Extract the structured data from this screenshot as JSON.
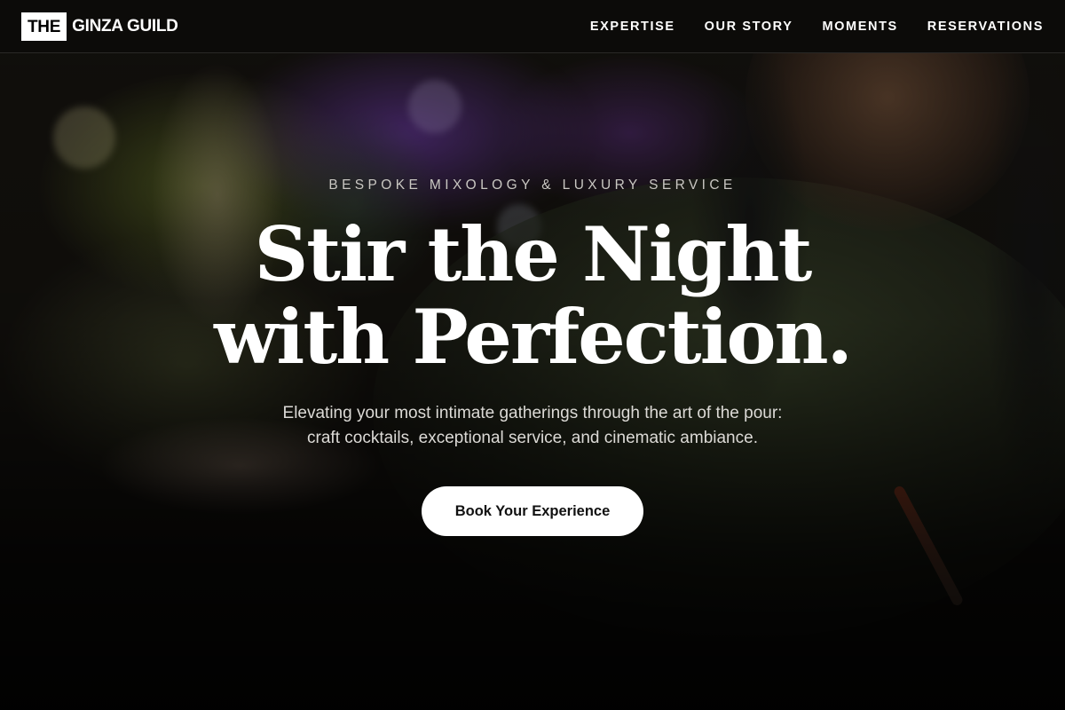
{
  "header": {
    "logo_box": "THE",
    "logo_text": "GINZA GUILD",
    "nav": [
      {
        "label": "EXPERTISE"
      },
      {
        "label": "OUR STORY"
      },
      {
        "label": "MOMENTS"
      },
      {
        "label": "RESERVATIONS"
      }
    ]
  },
  "hero": {
    "eyebrow": "BESPOKE MIXOLOGY & LUXURY SERVICE",
    "headline_line1": "Stir the Night",
    "headline_line2": "with Perfection.",
    "subtitle_line1": "Elevating your most intimate gatherings through the art of the pour:",
    "subtitle_line2": "craft cocktails, exceptional service, and cinematic ambiance.",
    "cta_label": "Book Your Experience"
  }
}
